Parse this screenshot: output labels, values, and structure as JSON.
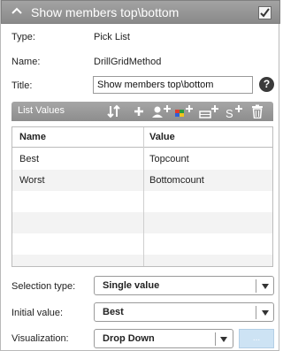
{
  "header": {
    "title": "Show members top\\bottom",
    "collapse_icon": "chevron-up-icon",
    "checked": true
  },
  "properties": {
    "type_label": "Type:",
    "type_value": "Pick List",
    "name_label": "Name:",
    "name_value": "DrillGridMethod",
    "title_label": "Title:",
    "title_value": "Show members top\\bottom",
    "help_text": "?"
  },
  "list_values": {
    "title": "List Values",
    "toolbar_icons": [
      "sort-icon",
      "add-icon",
      "add-user-icon",
      "add-color-icon",
      "add-row-icon",
      "add-s-icon",
      "delete-icon"
    ],
    "columns": [
      "Name",
      "Value"
    ],
    "rows": [
      {
        "name": "Best",
        "value": "Topcount"
      },
      {
        "name": "Worst",
        "value": "Bottomcount"
      }
    ]
  },
  "selection_type": {
    "label": "Selection type:",
    "value": "Single value"
  },
  "initial_value": {
    "label": "Initial value:",
    "value": "Best"
  },
  "visualization": {
    "label": "Visualization:",
    "value": "Drop Down",
    "extra_button": "..."
  },
  "colors": {
    "header_bg": "#959595",
    "accent_blue": "#cde3f4",
    "help_bg": "#3a3a3a"
  }
}
